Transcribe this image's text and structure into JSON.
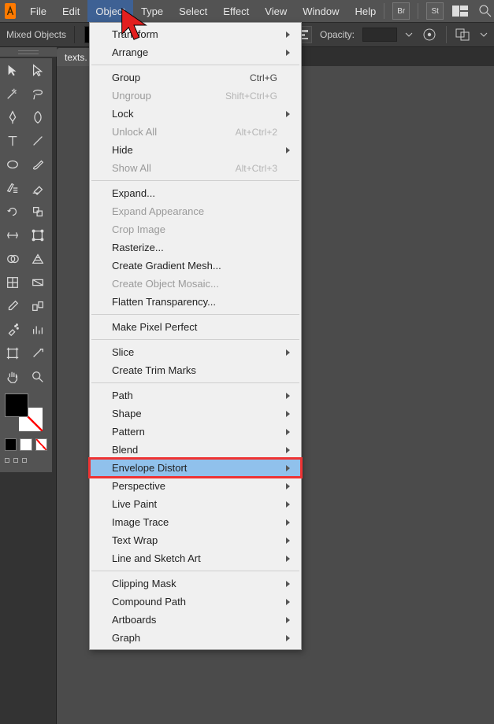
{
  "menubar": {
    "items": [
      "File",
      "Edit",
      "Object",
      "Type",
      "Select",
      "Effect",
      "View",
      "Window",
      "Help"
    ],
    "active_index": 2,
    "right_icons": [
      "Br",
      "St",
      "layout",
      "search",
      "rocket"
    ]
  },
  "optbar": {
    "label_left": "Mixed Objects",
    "opacity_label": "Opacity:",
    "opacity_value": ""
  },
  "document_tab": "texts.",
  "tool_names_rows": [
    [
      "selection-tool",
      "direct-selection-tool"
    ],
    [
      "magic-wand-tool",
      "lasso-tool"
    ],
    [
      "pen-tool",
      "curvature-tool"
    ],
    [
      "type-tool",
      "line-segment-tool"
    ],
    [
      "ellipse-tool",
      "paintbrush-tool"
    ],
    [
      "shaper-tool",
      "eraser-tool"
    ],
    [
      "rotate-tool",
      "scale-tool"
    ],
    [
      "width-tool",
      "free-transform-tool"
    ],
    [
      "shape-builder-tool",
      "perspective-grid-tool"
    ],
    [
      "mesh-tool",
      "gradient-tool"
    ],
    [
      "eyedropper-tool",
      "blend-tool"
    ],
    [
      "symbol-sprayer-tool",
      "column-graph-tool"
    ],
    [
      "artboard-tool",
      "slice-tool"
    ],
    [
      "hand-tool",
      "zoom-tool"
    ]
  ],
  "dropdown": [
    {
      "t": "item",
      "label": "Transform",
      "sub": true
    },
    {
      "t": "item",
      "label": "Arrange",
      "sub": true
    },
    {
      "t": "sep"
    },
    {
      "t": "item",
      "label": "Group",
      "shortcut": "Ctrl+G"
    },
    {
      "t": "item",
      "label": "Ungroup",
      "shortcut": "Shift+Ctrl+G",
      "disabled": true
    },
    {
      "t": "item",
      "label": "Lock",
      "sub": true
    },
    {
      "t": "item",
      "label": "Unlock All",
      "shortcut": "Alt+Ctrl+2",
      "disabled": true
    },
    {
      "t": "item",
      "label": "Hide",
      "sub": true
    },
    {
      "t": "item",
      "label": "Show All",
      "shortcut": "Alt+Ctrl+3",
      "disabled": true
    },
    {
      "t": "sep"
    },
    {
      "t": "item",
      "label": "Expand..."
    },
    {
      "t": "item",
      "label": "Expand Appearance",
      "disabled": true
    },
    {
      "t": "item",
      "label": "Crop Image",
      "disabled": true
    },
    {
      "t": "item",
      "label": "Rasterize..."
    },
    {
      "t": "item",
      "label": "Create Gradient Mesh..."
    },
    {
      "t": "item",
      "label": "Create Object Mosaic...",
      "disabled": true
    },
    {
      "t": "item",
      "label": "Flatten Transparency..."
    },
    {
      "t": "sep"
    },
    {
      "t": "item",
      "label": "Make Pixel Perfect"
    },
    {
      "t": "sep"
    },
    {
      "t": "item",
      "label": "Slice",
      "sub": true
    },
    {
      "t": "item",
      "label": "Create Trim Marks"
    },
    {
      "t": "sep"
    },
    {
      "t": "item",
      "label": "Path",
      "sub": true
    },
    {
      "t": "item",
      "label": "Shape",
      "sub": true
    },
    {
      "t": "item",
      "label": "Pattern",
      "sub": true
    },
    {
      "t": "item",
      "label": "Blend",
      "sub": true
    },
    {
      "t": "item",
      "label": "Envelope Distort",
      "sub": true,
      "hl": true
    },
    {
      "t": "item",
      "label": "Perspective",
      "sub": true
    },
    {
      "t": "item",
      "label": "Live Paint",
      "sub": true
    },
    {
      "t": "item",
      "label": "Image Trace",
      "sub": true
    },
    {
      "t": "item",
      "label": "Text Wrap",
      "sub": true
    },
    {
      "t": "item",
      "label": "Line and Sketch Art",
      "sub": true
    },
    {
      "t": "sep"
    },
    {
      "t": "item",
      "label": "Clipping Mask",
      "sub": true
    },
    {
      "t": "item",
      "label": "Compound Path",
      "sub": true
    },
    {
      "t": "item",
      "label": "Artboards",
      "sub": true
    },
    {
      "t": "item",
      "label": "Graph",
      "sub": true
    }
  ]
}
